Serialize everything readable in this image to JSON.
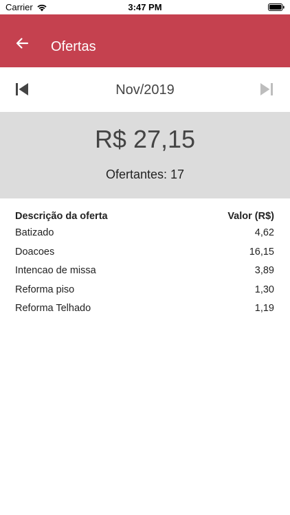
{
  "status_bar": {
    "carrier": "Carrier",
    "time": "3:47 PM"
  },
  "app_bar": {
    "title": "Ofertas",
    "color": "#c5414f",
    "back_icon": "arrow-left-icon"
  },
  "month_nav": {
    "month": "Nov/2019",
    "first_icon": "skip-first-icon",
    "last_icon": "skip-last-icon"
  },
  "summary": {
    "total": "R$ 27,15",
    "ofertantes": "Ofertantes: 17"
  },
  "table": {
    "header": {
      "description": "Descrição da oferta",
      "value": "Valor (R$)"
    },
    "rows": [
      {
        "description": "Batizado",
        "value": "4,62"
      },
      {
        "description": "Doacoes",
        "value": "16,15"
      },
      {
        "description": "Intencao de missa",
        "value": "3,89"
      },
      {
        "description": "Reforma piso",
        "value": "1,30"
      },
      {
        "description": "Reforma Telhado",
        "value": "1,19"
      }
    ]
  }
}
